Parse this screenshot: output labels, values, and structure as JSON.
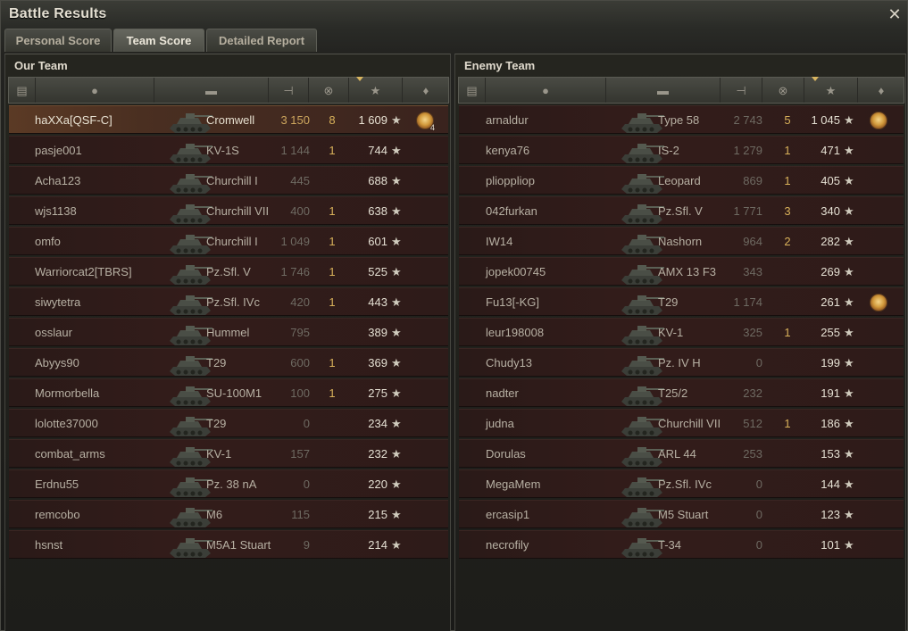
{
  "window": {
    "title": "Battle Results",
    "close_glyph": "✕"
  },
  "tabs": [
    {
      "label": "Personal Score",
      "active": false
    },
    {
      "label": "Team Score",
      "active": true
    },
    {
      "label": "Detailed Report",
      "active": false
    }
  ],
  "columns": [
    {
      "icon": "squad-icon"
    },
    {
      "icon": "player-icon"
    },
    {
      "icon": "tank-icon"
    },
    {
      "icon": "damage-icon"
    },
    {
      "icon": "kills-icon"
    },
    {
      "icon": "xp-star-icon",
      "sorted": true
    },
    {
      "icon": "medal-icon"
    }
  ],
  "our_team": {
    "title": "Our Team",
    "players": [
      {
        "name": "haXXa[QSF-C]",
        "tank": "Cromwell",
        "damage": "3 150",
        "kills": "8",
        "xp": "1 609",
        "medal": true,
        "medal_count": "4",
        "me": true
      },
      {
        "name": "pasje001",
        "tank": "KV-1S",
        "damage": "1 144",
        "kills": "1",
        "xp": "744"
      },
      {
        "name": "Acha123",
        "tank": "Churchill I",
        "damage": "445",
        "kills": "",
        "xp": "688"
      },
      {
        "name": "wjs1138",
        "tank": "Churchill VII",
        "damage": "400",
        "kills": "1",
        "xp": "638"
      },
      {
        "name": "omfo",
        "tank": "Churchill I",
        "damage": "1 049",
        "kills": "1",
        "xp": "601"
      },
      {
        "name": "Warriorcat2[TBRS]",
        "tank": "Pz.Sfl. V",
        "damage": "1 746",
        "kills": "1",
        "xp": "525"
      },
      {
        "name": "siwytetra",
        "tank": "Pz.Sfl. IVc",
        "damage": "420",
        "kills": "1",
        "xp": "443"
      },
      {
        "name": "osslaur",
        "tank": "Hummel",
        "damage": "795",
        "kills": "",
        "xp": "389"
      },
      {
        "name": "Abyys90",
        "tank": "T29",
        "damage": "600",
        "kills": "1",
        "xp": "369"
      },
      {
        "name": "Mormorbella",
        "tank": "SU-100M1",
        "damage": "100",
        "kills": "1",
        "xp": "275"
      },
      {
        "name": "lolotte37000",
        "tank": "T29",
        "damage": "0",
        "kills": "",
        "xp": "234"
      },
      {
        "name": "combat_arms",
        "tank": "KV-1",
        "damage": "157",
        "kills": "",
        "xp": "232"
      },
      {
        "name": "Erdnu55",
        "tank": "Pz. 38 nA",
        "damage": "0",
        "kills": "",
        "xp": "220"
      },
      {
        "name": "remcobo",
        "tank": "M6",
        "damage": "115",
        "kills": "",
        "xp": "215"
      },
      {
        "name": "hsnst",
        "tank": "M5A1 Stuart",
        "damage": "9",
        "kills": "",
        "xp": "214"
      }
    ]
  },
  "enemy_team": {
    "title": "Enemy Team",
    "players": [
      {
        "name": "arnaldur",
        "tank": "Type 58",
        "damage": "2 743",
        "kills": "5",
        "xp": "1 045",
        "medal": true
      },
      {
        "name": "kenya76",
        "tank": "IS-2",
        "damage": "1 279",
        "kills": "1",
        "xp": "471"
      },
      {
        "name": "plioppliop",
        "tank": "Leopard",
        "damage": "869",
        "kills": "1",
        "xp": "405"
      },
      {
        "name": "042furkan",
        "tank": "Pz.Sfl. V",
        "damage": "1 771",
        "kills": "3",
        "xp": "340"
      },
      {
        "name": "IW14",
        "tank": "Nashorn",
        "damage": "964",
        "kills": "2",
        "xp": "282"
      },
      {
        "name": "jopek00745",
        "tank": "AMX 13 F3",
        "damage": "343",
        "kills": "",
        "xp": "269"
      },
      {
        "name": "Fu13[-KG]",
        "tank": "T29",
        "damage": "1 174",
        "kills": "",
        "xp": "261",
        "medal": true
      },
      {
        "name": "leur198008",
        "tank": "KV-1",
        "damage": "325",
        "kills": "1",
        "xp": "255"
      },
      {
        "name": "Chudy13",
        "tank": "Pz. IV H",
        "damage": "0",
        "kills": "",
        "xp": "199"
      },
      {
        "name": "nadter",
        "tank": "T25/2",
        "damage": "232",
        "kills": "",
        "xp": "191"
      },
      {
        "name": "judna",
        "tank": "Churchill VII",
        "damage": "512",
        "kills": "1",
        "xp": "186"
      },
      {
        "name": "Dorulas",
        "tank": "ARL 44",
        "damage": "253",
        "kills": "",
        "xp": "153"
      },
      {
        "name": "MegaMem",
        "tank": "Pz.Sfl. IVc",
        "damage": "0",
        "kills": "",
        "xp": "144"
      },
      {
        "name": "ercasip1",
        "tank": "M5 Stuart",
        "damage": "0",
        "kills": "",
        "xp": "123"
      },
      {
        "name": "necrofily",
        "tank": "T-34",
        "damage": "0",
        "kills": "",
        "xp": "101"
      }
    ]
  },
  "star_glyph": "★"
}
